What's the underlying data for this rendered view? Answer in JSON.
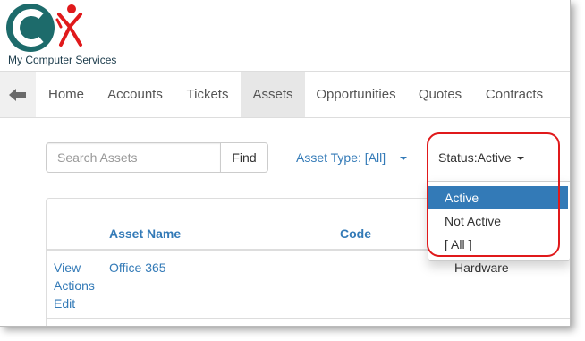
{
  "brand": {
    "company_name": "My Computer Services",
    "colors": {
      "teal": "#1d6b6b",
      "red": "#e0191b",
      "link": "#337ab7"
    }
  },
  "nav": {
    "back_icon": "arrow-left-icon",
    "items": [
      {
        "label": "Home"
      },
      {
        "label": "Accounts"
      },
      {
        "label": "Tickets"
      },
      {
        "label": "Assets",
        "active": true
      },
      {
        "label": "Opportunities"
      },
      {
        "label": "Quotes"
      },
      {
        "label": "Contracts"
      }
    ]
  },
  "toolbar": {
    "search_placeholder": "Search Assets",
    "find_label": "Find",
    "asset_type_label": "Asset Type: [All]",
    "status_label": "Status:Active"
  },
  "status_menu": {
    "options": [
      {
        "label": "Active",
        "selected": true
      },
      {
        "label": "Not Active"
      },
      {
        "label": "[ All ]"
      }
    ]
  },
  "table": {
    "headers": {
      "asset_name": "Asset Name",
      "code": "Code"
    },
    "rows": [
      {
        "actions": [
          "View",
          "Actions",
          "Edit"
        ],
        "asset_name": "Office 365",
        "type": "Hardware"
      }
    ]
  }
}
